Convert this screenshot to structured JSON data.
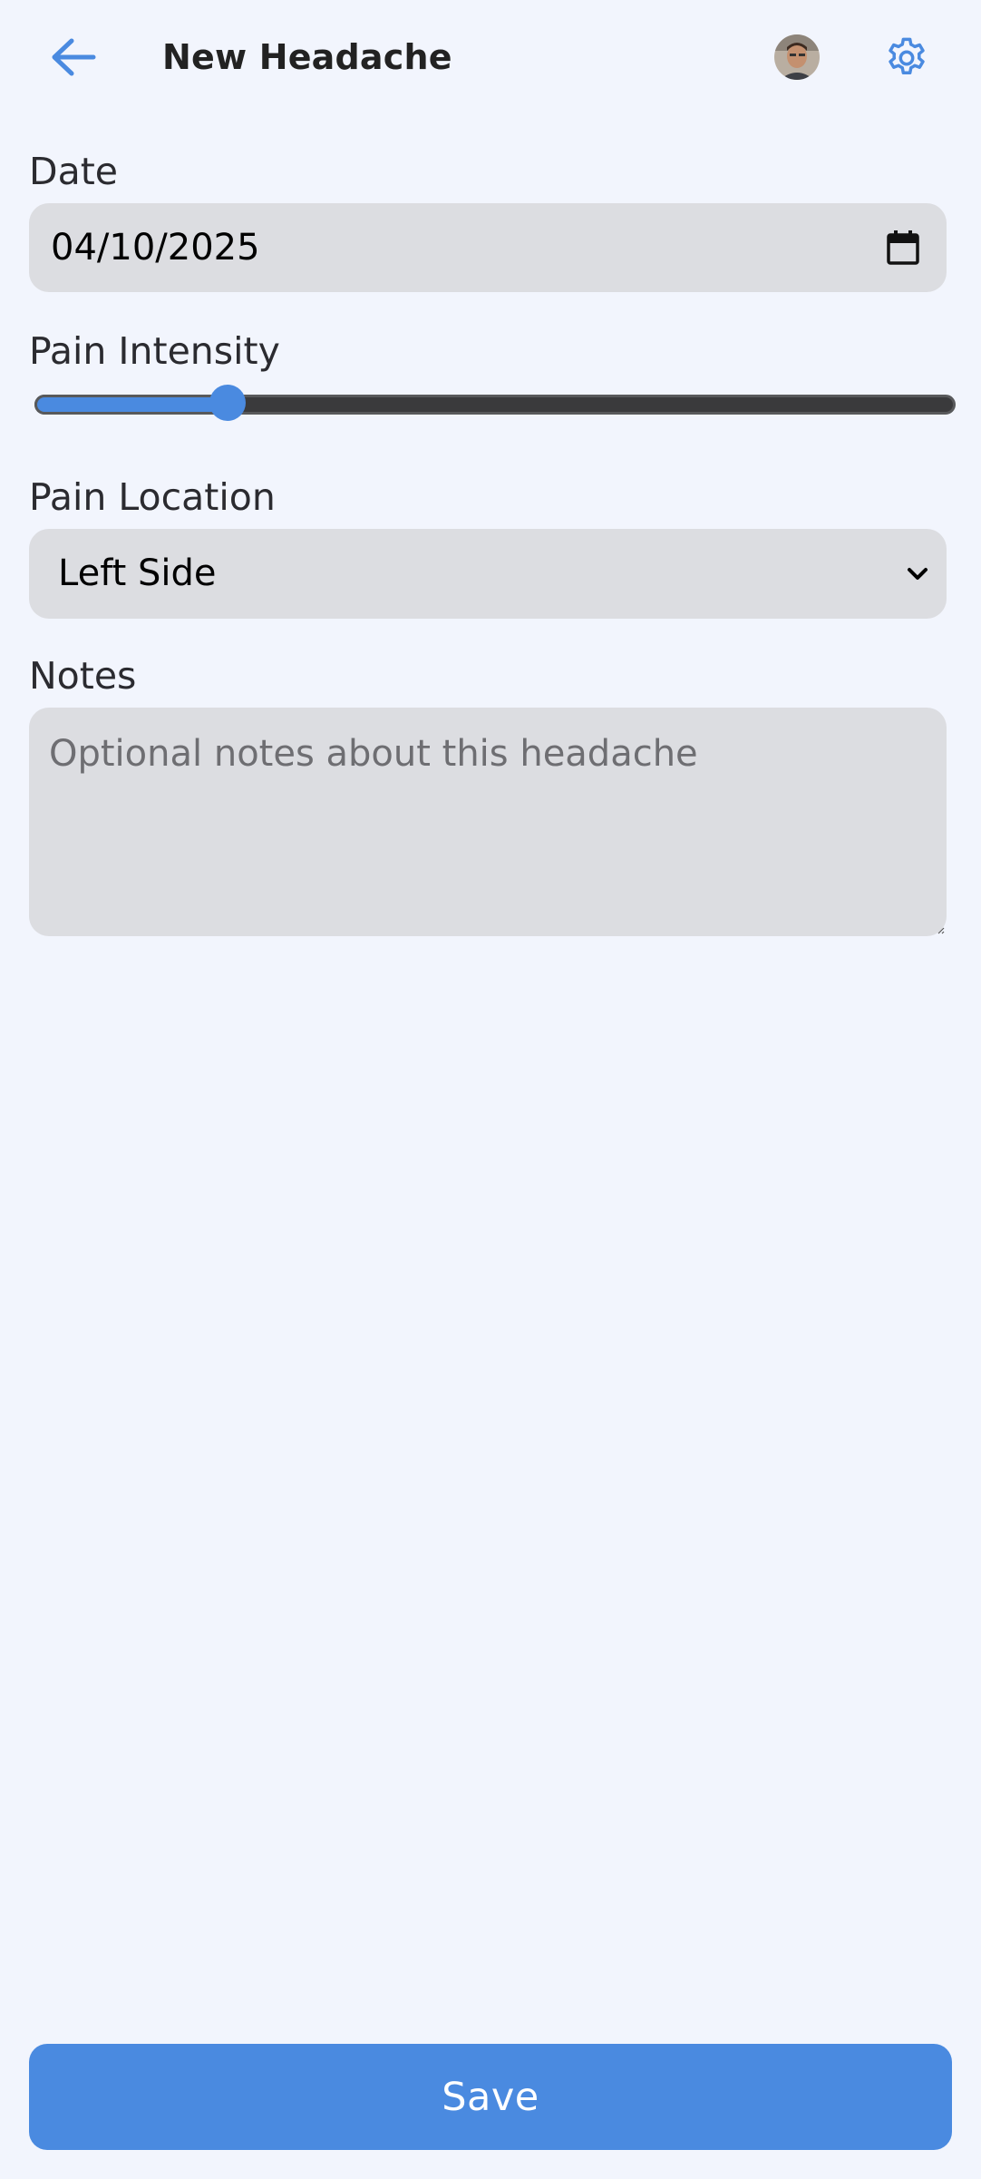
{
  "header": {
    "title": "New Headache",
    "back_icon": "arrow-left-icon",
    "settings_icon": "gear-icon",
    "accent_color": "#4a8ae0"
  },
  "form": {
    "date": {
      "label": "Date",
      "value": "04/10/2025",
      "icon": "calendar-icon"
    },
    "pain_intensity": {
      "label": "Pain Intensity",
      "fraction": 0.21
    },
    "pain_location": {
      "label": "Pain Location",
      "selected": "Left Side"
    },
    "notes": {
      "label": "Notes",
      "value": "",
      "placeholder": "Optional notes about this headache"
    }
  },
  "actions": {
    "save_label": "Save"
  }
}
